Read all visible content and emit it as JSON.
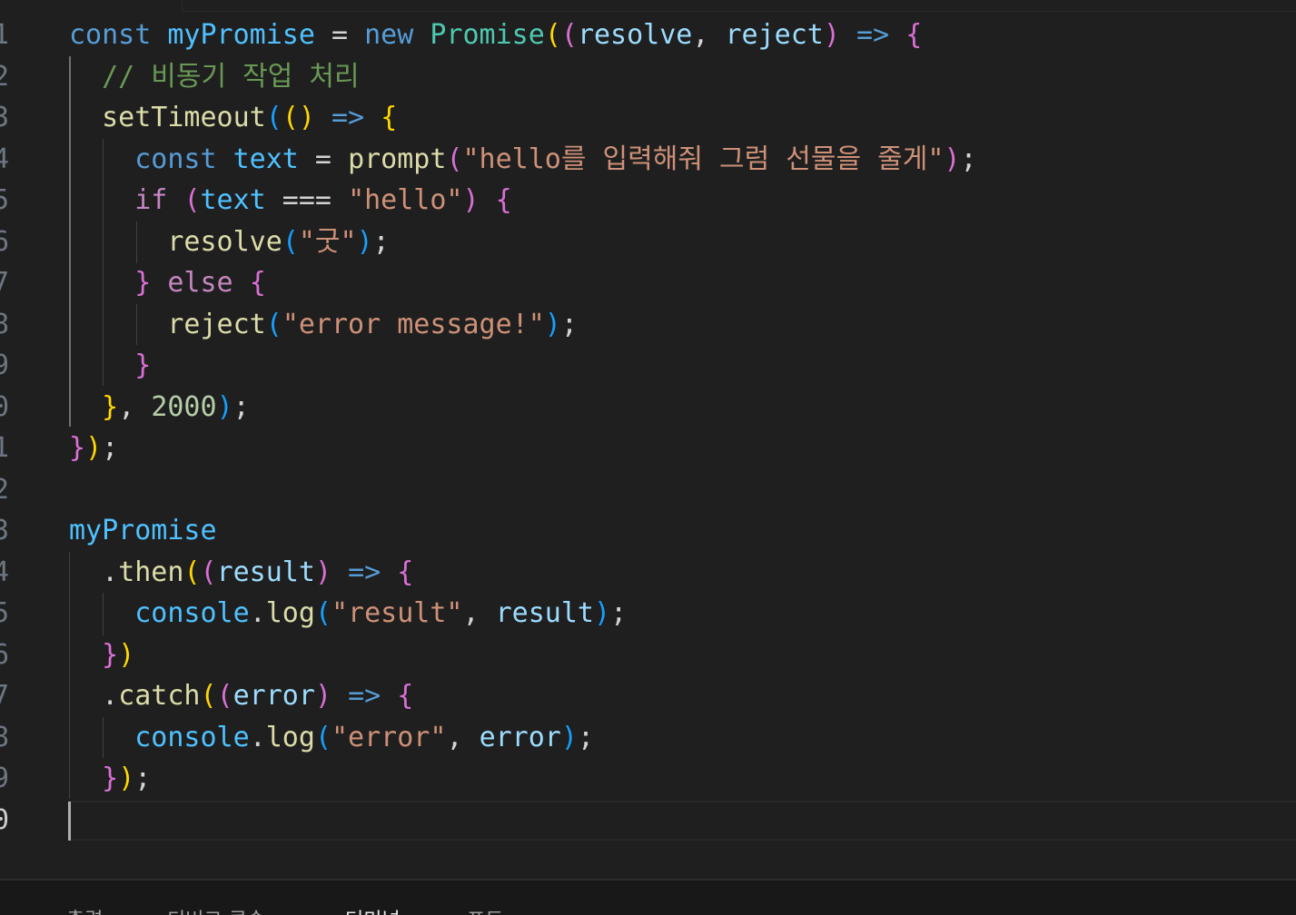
{
  "editor": {
    "line_numbers": [
      "1",
      "2",
      "3",
      "4",
      "5",
      "6",
      "7",
      "8",
      "9",
      "0",
      "1",
      "2",
      "3",
      "4",
      "5",
      "6",
      "7",
      "8",
      "9",
      "0"
    ],
    "active_line_index": 19,
    "lines": [
      [
        [
          "kw",
          "const"
        ],
        [
          "pn",
          " "
        ],
        [
          "var",
          "myPromise"
        ],
        [
          "pn",
          " = "
        ],
        [
          "kw",
          "new"
        ],
        [
          "pn",
          " "
        ],
        [
          "cls",
          "Promise"
        ],
        [
          "b1",
          "("
        ],
        [
          "b2",
          "("
        ],
        [
          "par",
          "resolve"
        ],
        [
          "pn",
          ", "
        ],
        [
          "par",
          "reject"
        ],
        [
          "b2",
          ")"
        ],
        [
          "pn",
          " "
        ],
        [
          "kw",
          "=>"
        ],
        [
          "pn",
          " "
        ],
        [
          "b2",
          "{"
        ]
      ],
      [
        [
          "pn",
          "  "
        ],
        [
          "cmt",
          "// 비동기 작업 처리"
        ]
      ],
      [
        [
          "pn",
          "  "
        ],
        [
          "fn",
          "setTimeout"
        ],
        [
          "b3",
          "("
        ],
        [
          "b1",
          "("
        ],
        [
          "b1",
          ")"
        ],
        [
          "pn",
          " "
        ],
        [
          "kw",
          "=>"
        ],
        [
          "pn",
          " "
        ],
        [
          "b1",
          "{"
        ]
      ],
      [
        [
          "pn",
          "    "
        ],
        [
          "kw",
          "const"
        ],
        [
          "pn",
          " "
        ],
        [
          "var",
          "text"
        ],
        [
          "pn",
          " = "
        ],
        [
          "fn",
          "prompt"
        ],
        [
          "b2",
          "("
        ],
        [
          "str",
          "\"hello를 입력해줘 그럼 선물을 줄게\""
        ],
        [
          "b2",
          ")"
        ],
        [
          "pn",
          ";"
        ]
      ],
      [
        [
          "pn",
          "    "
        ],
        [
          "ctl",
          "if"
        ],
        [
          "pn",
          " "
        ],
        [
          "b2",
          "("
        ],
        [
          "var",
          "text"
        ],
        [
          "pn",
          " === "
        ],
        [
          "str",
          "\"hello\""
        ],
        [
          "b2",
          ")"
        ],
        [
          "pn",
          " "
        ],
        [
          "b2",
          "{"
        ]
      ],
      [
        [
          "pn",
          "      "
        ],
        [
          "fn",
          "resolve"
        ],
        [
          "b3",
          "("
        ],
        [
          "str",
          "\"굿\""
        ],
        [
          "b3",
          ")"
        ],
        [
          "pn",
          ";"
        ]
      ],
      [
        [
          "pn",
          "    "
        ],
        [
          "b2",
          "}"
        ],
        [
          "pn",
          " "
        ],
        [
          "ctl",
          "else"
        ],
        [
          "pn",
          " "
        ],
        [
          "b2",
          "{"
        ]
      ],
      [
        [
          "pn",
          "      "
        ],
        [
          "fn",
          "reject"
        ],
        [
          "b3",
          "("
        ],
        [
          "str",
          "\"error message!\""
        ],
        [
          "b3",
          ")"
        ],
        [
          "pn",
          ";"
        ]
      ],
      [
        [
          "pn",
          "    "
        ],
        [
          "b2",
          "}"
        ]
      ],
      [
        [
          "pn",
          "  "
        ],
        [
          "b1",
          "}"
        ],
        [
          "pn",
          ", "
        ],
        [
          "num",
          "2000"
        ],
        [
          "b3",
          ")"
        ],
        [
          "pn",
          ";"
        ]
      ],
      [
        [
          "b2",
          "}"
        ],
        [
          "b1",
          ")"
        ],
        [
          "pn",
          ";"
        ]
      ],
      [],
      [
        [
          "var",
          "myPromise"
        ]
      ],
      [
        [
          "pn",
          "  ."
        ],
        [
          "fn",
          "then"
        ],
        [
          "b1",
          "("
        ],
        [
          "b2",
          "("
        ],
        [
          "par",
          "result"
        ],
        [
          "b2",
          ")"
        ],
        [
          "pn",
          " "
        ],
        [
          "kw",
          "=>"
        ],
        [
          "pn",
          " "
        ],
        [
          "b2",
          "{"
        ]
      ],
      [
        [
          "pn",
          "    "
        ],
        [
          "var",
          "console"
        ],
        [
          "pn",
          "."
        ],
        [
          "fn",
          "log"
        ],
        [
          "b3",
          "("
        ],
        [
          "str",
          "\"result\""
        ],
        [
          "pn",
          ", "
        ],
        [
          "par",
          "result"
        ],
        [
          "b3",
          ")"
        ],
        [
          "pn",
          ";"
        ]
      ],
      [
        [
          "pn",
          "  "
        ],
        [
          "b2",
          "}"
        ],
        [
          "b1",
          ")"
        ]
      ],
      [
        [
          "pn",
          "  ."
        ],
        [
          "fn",
          "catch"
        ],
        [
          "b1",
          "("
        ],
        [
          "b2",
          "("
        ],
        [
          "par",
          "error"
        ],
        [
          "b2",
          ")"
        ],
        [
          "pn",
          " "
        ],
        [
          "kw",
          "=>"
        ],
        [
          "pn",
          " "
        ],
        [
          "b2",
          "{"
        ]
      ],
      [
        [
          "pn",
          "    "
        ],
        [
          "var",
          "console"
        ],
        [
          "pn",
          "."
        ],
        [
          "fn",
          "log"
        ],
        [
          "b3",
          "("
        ],
        [
          "str",
          "\"error\""
        ],
        [
          "pn",
          ", "
        ],
        [
          "par",
          "error"
        ],
        [
          "b3",
          ")"
        ],
        [
          "pn",
          ";"
        ]
      ],
      [
        [
          "pn",
          "  "
        ],
        [
          "b2",
          "}"
        ],
        [
          "b1",
          ")"
        ],
        [
          "pn",
          ";"
        ]
      ],
      []
    ]
  },
  "panel": {
    "tabs": [
      {
        "label": "출력",
        "active": false
      },
      {
        "label": "디버그 콘솔",
        "active": false
      },
      {
        "label": "터미널",
        "active": true
      },
      {
        "label": "포트",
        "active": false
      }
    ]
  }
}
